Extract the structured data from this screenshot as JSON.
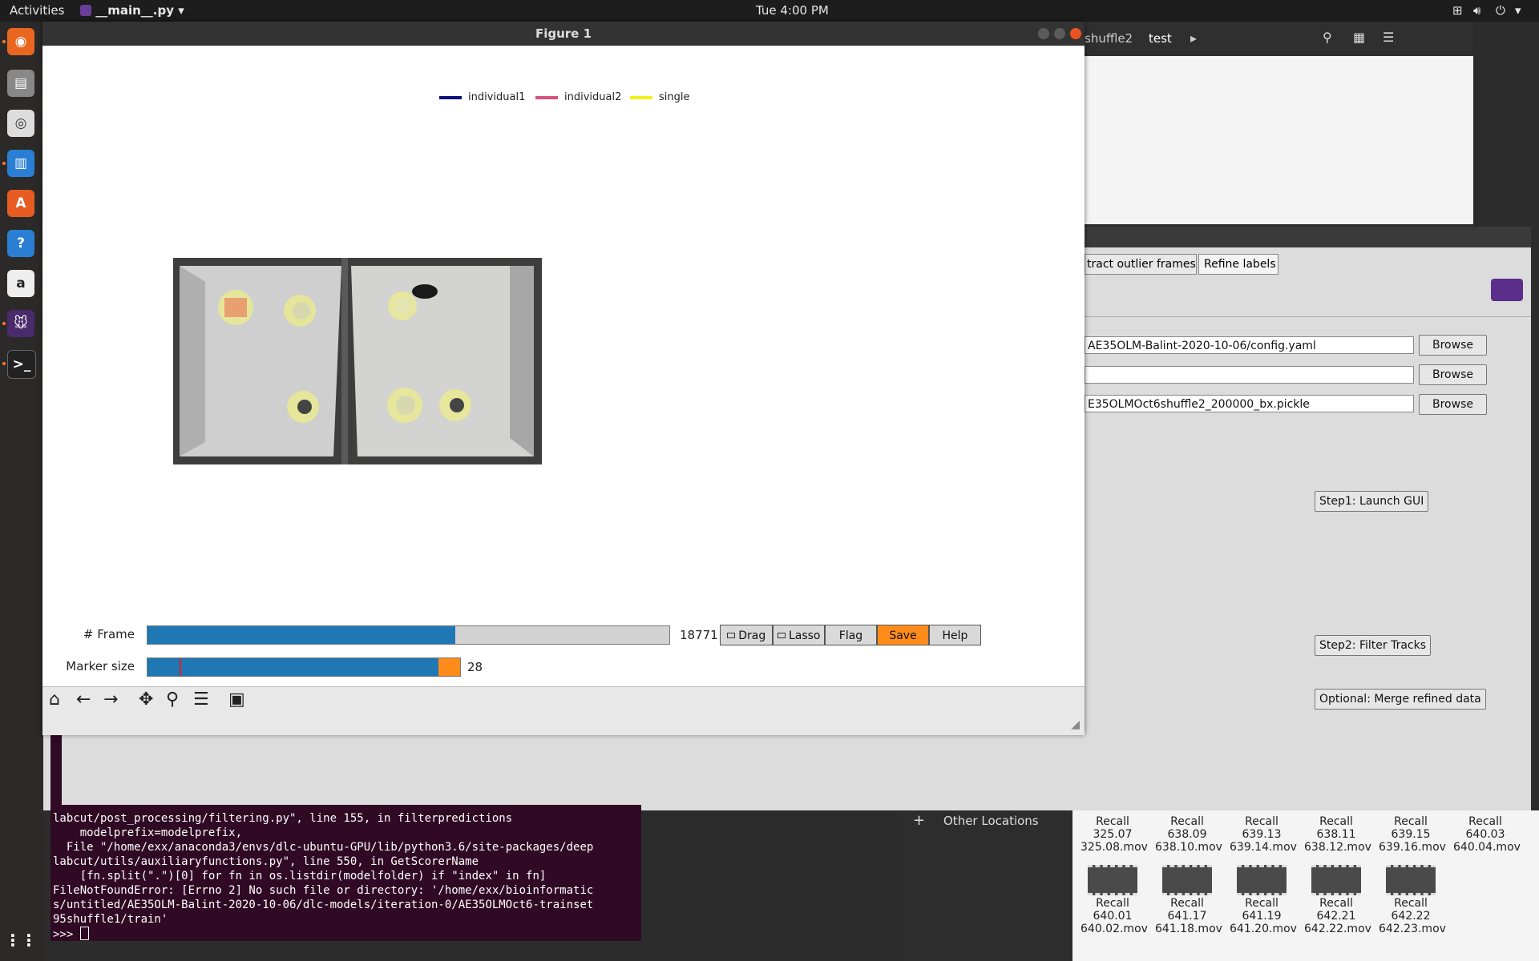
{
  "topbar": {
    "activities": "Activities",
    "app_name": "__main__.py",
    "datetime": "Tue  4:00 PM"
  },
  "figure": {
    "title": "Figure 1",
    "legend": [
      {
        "label": "individual1",
        "color": "#0b0f7d"
      },
      {
        "label": "individual2",
        "color": "#d6527a"
      },
      {
        "label": "single",
        "color": "#f2f21a"
      }
    ],
    "frame_label": "# Frame",
    "frame_value": "18771",
    "frame_fraction": 0.59,
    "marker_label": "Marker size",
    "marker_value": "28",
    "marker_fraction": 0.93,
    "buttons": {
      "drag": "Drag",
      "lasso": "Lasso",
      "flag": "Flag",
      "save": "Save",
      "help": "Help"
    },
    "accent": "#1f77b4",
    "save_color": "#ff8c1a"
  },
  "background_window": {
    "tabs": [
      "shuffle2",
      "test"
    ]
  },
  "dlc": {
    "tabs": [
      "tract outlier frames",
      "Refine labels"
    ],
    "paths": [
      "AE35OLM-Balint-2020-10-06/config.yaml",
      "",
      "E35OLMOct6shuffle2_200000_bx.pickle"
    ],
    "browse": "Browse",
    "step1": "Step1: Launch GUI",
    "step2": "Step2: Filter Tracks",
    "merge": "Optional: Merge refined data"
  },
  "terminal": {
    "lines": [
      "labcut/post_processing/filtering.py\", line 155, in filterpredictions",
      "    modelprefix=modelprefix,",
      "  File \"/home/exx/anaconda3/envs/dlc-ubuntu-GPU/lib/python3.6/site-packages/deep",
      "labcut/utils/auxiliaryfunctions.py\", line 550, in GetScorerName",
      "    [fn.split(\".\")[0] for fn in os.listdir(modelfolder) if \"index\" in fn]",
      "FileNotFoundError: [Errno 2] No such file or directory: '/home/exx/bioinformatic",
      "s/untitled/AE35OLM-Balint-2020-10-06/dlc-models/iteration-0/AE35OLMOct6-trainset",
      "95shuffle1/train'",
      ">>> "
    ]
  },
  "files": {
    "other_locations": "Other Locations",
    "row1": [
      {
        "l1": "Recall",
        "l2": "325.07",
        "l3": "325.08.mov"
      },
      {
        "l1": "Recall",
        "l2": "638.09",
        "l3": "638.10.mov"
      },
      {
        "l1": "Recall",
        "l2": "639.13",
        "l3": "639.14.mov"
      },
      {
        "l1": "Recall",
        "l2": "638.11",
        "l3": "638.12.mov"
      },
      {
        "l1": "Recall",
        "l2": "639.15",
        "l3": "639.16.mov"
      },
      {
        "l1": "Recall",
        "l2": "640.03",
        "l3": "640.04.mov"
      }
    ],
    "row2": [
      {
        "l1": "Recall",
        "l2": "640.01",
        "l3": "640.02.mov"
      },
      {
        "l1": "Recall",
        "l2": "641.17",
        "l3": "641.18.mov"
      },
      {
        "l1": "Recall",
        "l2": "641.19",
        "l3": "641.20.mov"
      },
      {
        "l1": "Recall",
        "l2": "642.21",
        "l3": "642.22.mov"
      },
      {
        "l1": "Recall",
        "l2": "642.22",
        "l3": "642.23.mov"
      }
    ]
  }
}
